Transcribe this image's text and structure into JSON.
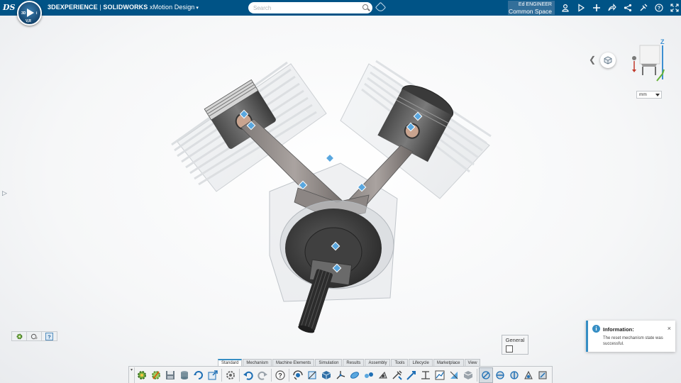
{
  "header": {
    "brand_bold": "3DEXPERIENCE",
    "brand_sep": " | ",
    "brand_solidworks": "SOLIDWORKS",
    "app_name": " xMotion Design",
    "compass_3d": "3D",
    "compass_version": "V,R",
    "compass_i": "i",
    "search_placeholder": "Search",
    "user_name": "Ed ENGINEER",
    "collab_space": "Common Space",
    "icons": [
      "user-icon",
      "share-play-icon",
      "add-icon",
      "share-icon",
      "network-icon",
      "tools-icon",
      "help-icon",
      "fullscreen-icon"
    ]
  },
  "viewer": {
    "units": "mm",
    "triad_axis_label": "Z"
  },
  "mini_toolbar": {
    "icons": [
      "gear-icon",
      "mechanism-icon",
      "help-icon"
    ]
  },
  "general_panel": {
    "label": "General"
  },
  "notification": {
    "title": "Information:",
    "message": "The reset mechanism state was successful.",
    "close": "×"
  },
  "action_bar": {
    "tabs": [
      "Standard",
      "Mechanism",
      "Machine Elements",
      "Simulation",
      "Results",
      "Assembly",
      "Tools",
      "Lifecycle",
      "Marketplace",
      "View"
    ],
    "active_tab": "Standard",
    "icons": [
      "reset-mechanism-icon",
      "mechanism-gear-icon",
      "save-icon",
      "save-as-icon",
      "refresh-icon",
      "export-icon",
      "settings-icon",
      "undo-icon",
      "redo-icon",
      "help-icon",
      "rotate-view-icon",
      "sketch-icon",
      "part-icon",
      "axis-icon",
      "joint-icon",
      "constraint-icon",
      "motion-icon",
      "driver-icon",
      "force-icon",
      "measure-icon",
      "plot-icon",
      "section-icon",
      "display-icon",
      "mechanism-a-icon",
      "mechanism-b-icon",
      "mechanism-c-icon",
      "mechanism-d-icon",
      "mechanism-e-icon"
    ]
  }
}
